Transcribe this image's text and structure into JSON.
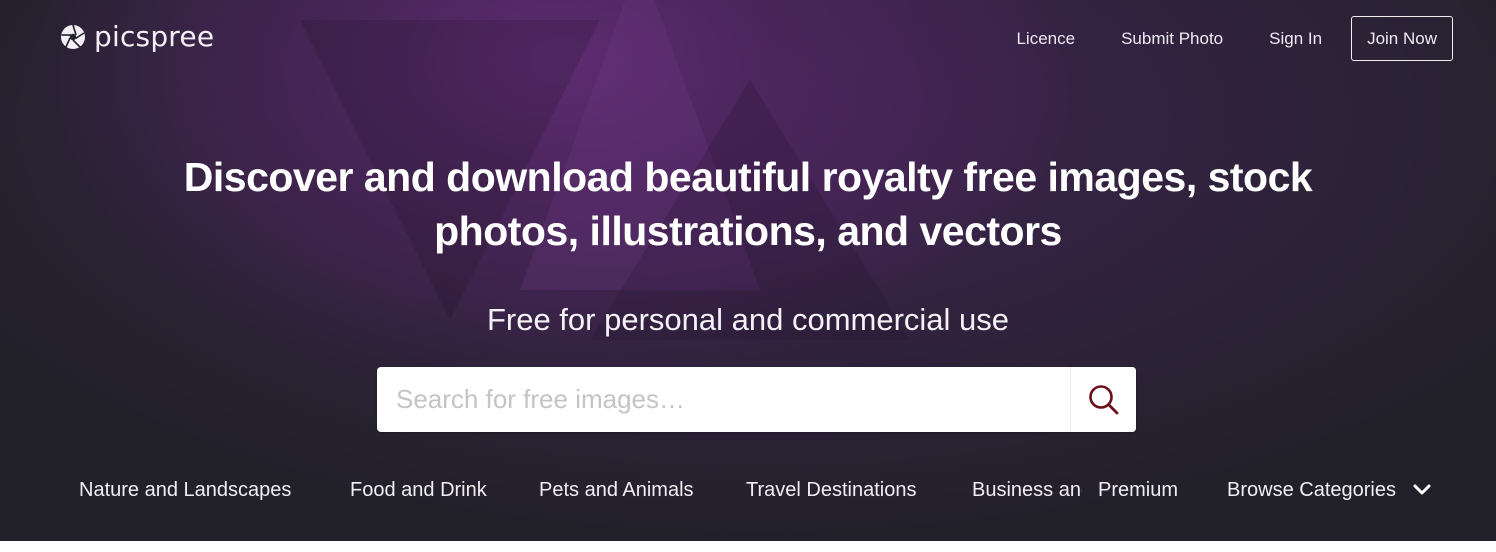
{
  "brand": {
    "name": "picspree",
    "logo_icon": "camera-shutter-icon"
  },
  "nav": {
    "links": [
      {
        "label": "Licence"
      },
      {
        "label": "Submit Photo"
      },
      {
        "label": "Sign In"
      }
    ],
    "join_label": "Join Now"
  },
  "hero": {
    "headline_line1": "Discover and download beautiful royalty free images, stock",
    "headline_line2": "photos, illustrations, and vectors",
    "subheadline": "Free for personal and commercial use"
  },
  "search": {
    "placeholder": "Search for free images…",
    "value": "",
    "button_icon": "search-icon",
    "icon_color": "#6b0f1a"
  },
  "categories": {
    "items": [
      {
        "label": "Nature and Landscapes"
      },
      {
        "label": "Food and Drink"
      },
      {
        "label": "Pets and Animals"
      },
      {
        "label": "Travel Destinations"
      },
      {
        "label": "Business and Technology"
      },
      {
        "label": "Premium"
      }
    ],
    "browse_label": "Browse Categories",
    "browse_icon": "chevron-down-icon"
  },
  "colors": {
    "background": "#22212a",
    "accent_purple": "#5e2c72",
    "text": "#ffffff"
  }
}
